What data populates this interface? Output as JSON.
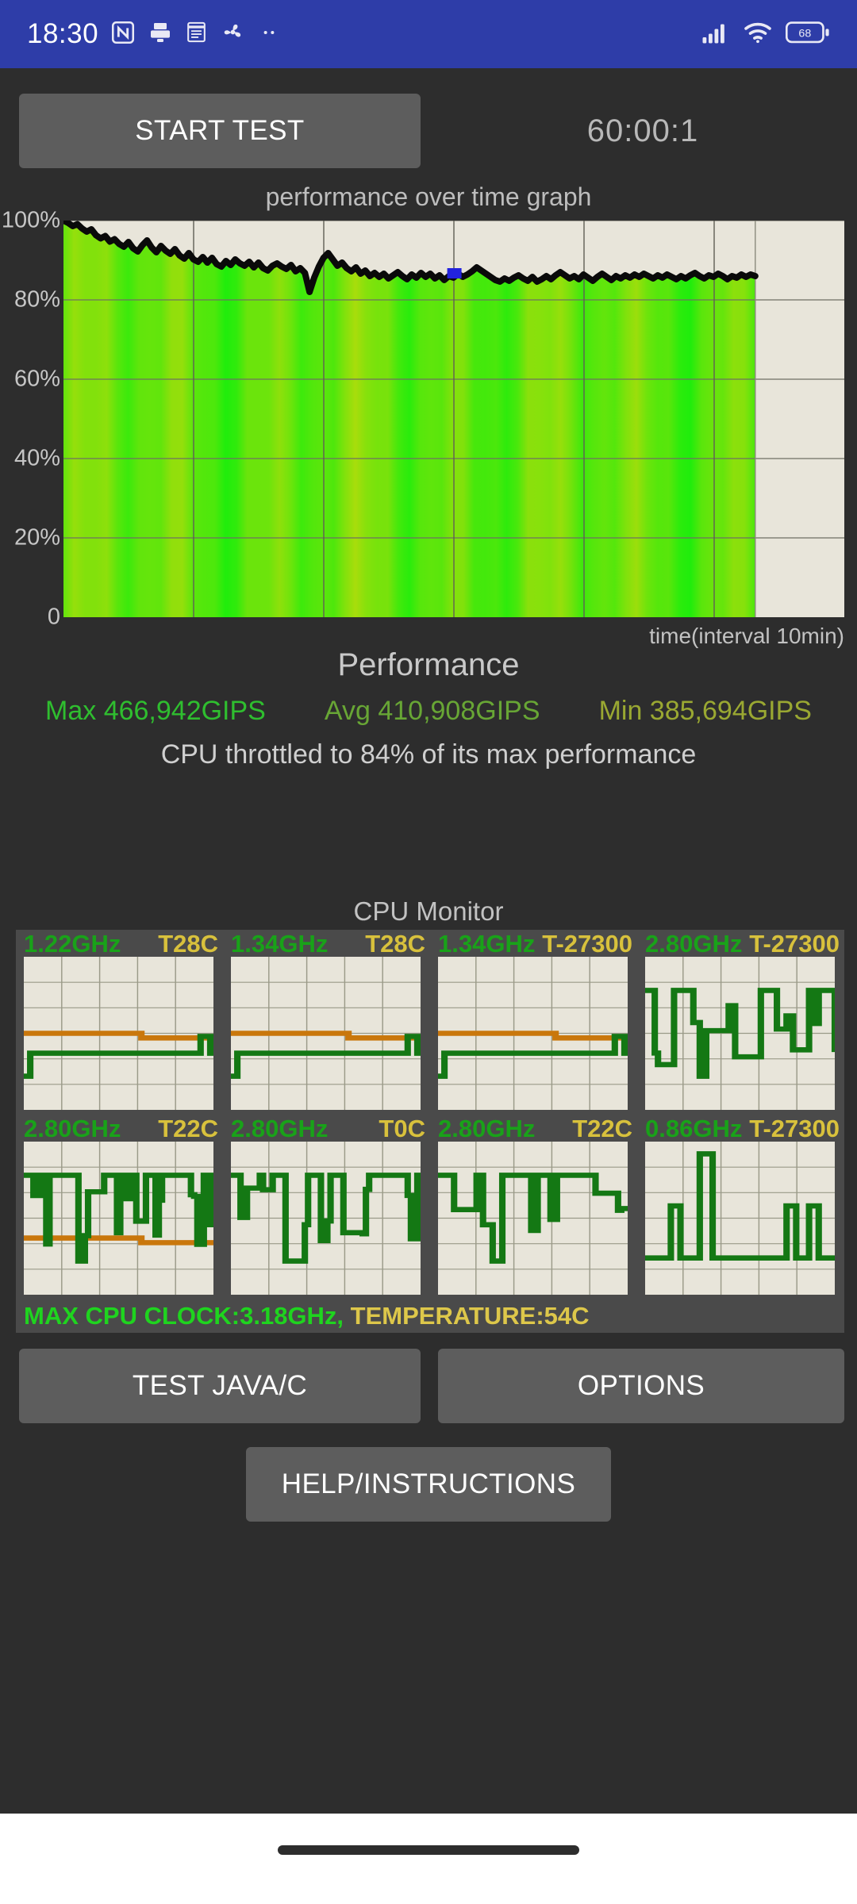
{
  "statusbar": {
    "clock": "18:30",
    "left_icons": [
      "nfc-icon",
      "scanner-icon",
      "notepad-icon",
      "fan-icon",
      "more-dots-icon"
    ],
    "right_icons": [
      "signal-icon",
      "wifi-icon",
      "battery-icon"
    ],
    "battery_level": "68",
    "background": "#2e3da8"
  },
  "toolbar": {
    "start_label": "START TEST",
    "timer": "60:00:1"
  },
  "chart": {
    "title": "performance over time graph",
    "xlabel": "time(interval 10min)",
    "yticks": [
      "100%",
      "80%",
      "60%",
      "40%",
      "20%",
      "0"
    ],
    "marker_color": "#2222dd"
  },
  "performance": {
    "title": "Performance",
    "max_label": "Max 466,942GIPS",
    "avg_label": "Avg 410,908GIPS",
    "min_label": "Min 385,694GIPS",
    "max_color": "#2fbe2f",
    "avg_color": "#68a635",
    "min_color": "#9aa832",
    "throttle_text": "CPU throttled to 84% of its max performance"
  },
  "cpu_monitor": {
    "title": "CPU Monitor",
    "cores": [
      {
        "ghz": "1.22GHz",
        "temp": "T28C"
      },
      {
        "ghz": "1.34GHz",
        "temp": "T28C"
      },
      {
        "ghz": "1.34GHz",
        "temp": "T-27300"
      },
      {
        "ghz": "2.80GHz",
        "temp": "T-27300"
      },
      {
        "ghz": "2.80GHz",
        "temp": "T22C"
      },
      {
        "ghz": "2.80GHz",
        "temp": "T0C"
      },
      {
        "ghz": "2.80GHz",
        "temp": "T22C"
      },
      {
        "ghz": "0.86GHz",
        "temp": "T-27300"
      }
    ],
    "max_clock_label": "MAX CPU CLOCK:3.18GHz,",
    "temperature_label": "TEMPERATURE:54C"
  },
  "buttons": {
    "test_java": "TEST JAVA/C",
    "options": "OPTIONS",
    "help": "HELP/INSTRUCTIONS"
  },
  "chart_data": {
    "type": "area",
    "title": "performance over time graph",
    "xlabel": "time(interval 10min)",
    "ylabel": "",
    "ylim": [
      0,
      100
    ],
    "ytick_values": [
      0,
      20,
      40,
      60,
      80,
      100
    ],
    "ytick_labels": [
      "0",
      "20%",
      "40%",
      "60%",
      "80%",
      "100%"
    ],
    "grid": true,
    "legend": "none",
    "x_unit": "10 min interval",
    "x_data_fraction": 0.886,
    "series": [
      {
        "name": "performance %",
        "values": [
          100,
          99.4,
          98.6,
          99.1,
          98.0,
          97.2,
          97.8,
          96.3,
          95.5,
          96.1,
          94.7,
          95.3,
          94.1,
          93.4,
          94.6,
          93.0,
          92.2,
          93.8,
          95.0,
          93.2,
          92.0,
          93.6,
          92.4,
          91.6,
          92.8,
          91.2,
          90.4,
          91.8,
          90.2,
          89.6,
          90.8,
          89.4,
          90.6,
          89.0,
          88.4,
          89.8,
          88.8,
          90.2,
          89.2,
          88.6,
          89.6,
          88.2,
          89.4,
          88.0,
          87.4,
          88.6,
          89.2,
          88.4,
          87.8,
          88.8,
          87.2,
          88.0,
          86.8,
          82.0,
          85.6,
          88.4,
          90.6,
          91.8,
          90.2,
          88.6,
          89.4,
          88.0,
          87.2,
          88.2,
          86.6,
          87.4,
          86.0,
          86.8,
          85.8,
          86.6,
          85.4,
          86.2,
          87.0,
          86.0,
          85.2,
          86.4,
          85.6,
          86.8,
          85.8,
          86.6,
          85.4,
          86.2,
          85.0,
          86.0,
          85.6,
          86.6,
          85.8,
          86.4,
          87.2,
          88.2,
          87.4,
          86.6,
          85.8,
          85.0,
          84.6,
          85.4,
          84.8,
          85.6,
          86.2,
          85.4,
          84.8,
          85.8,
          84.6,
          85.2,
          86.0,
          85.2,
          86.2,
          87.0,
          86.2,
          85.4,
          86.0,
          85.2,
          86.4,
          85.6,
          84.8,
          85.8,
          86.6,
          85.8,
          85.0,
          86.0,
          85.4,
          86.2,
          85.6,
          86.4,
          85.8,
          86.6,
          86.0,
          85.4,
          86.2,
          85.6,
          86.4,
          85.8,
          85.2,
          86.0,
          85.4,
          86.2,
          86.8,
          86.0,
          85.4,
          86.2,
          85.8,
          86.6,
          86.0,
          85.2,
          86.0,
          85.6,
          86.4,
          85.8,
          86.4,
          86.0
        ]
      }
    ],
    "annotations": [
      {
        "type": "marker",
        "x_fraction": 0.565,
        "y": 87.0,
        "color": "#2222dd"
      }
    ],
    "summary": {
      "max": 466942,
      "avg": 410908,
      "min": 385694,
      "unit": "GIPS",
      "throttled_to_percent": 84
    }
  }
}
